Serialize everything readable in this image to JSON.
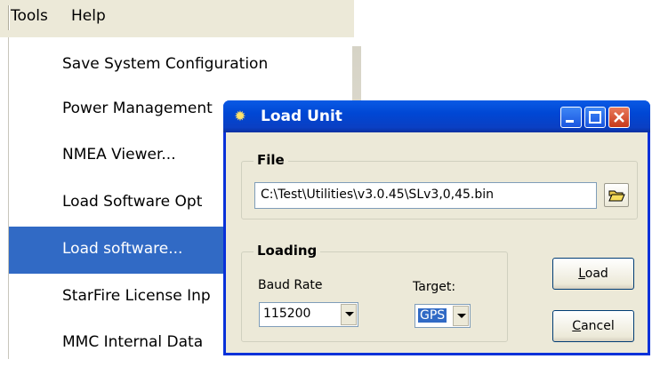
{
  "menubar": {
    "tools": "Tools",
    "help": "Help"
  },
  "menu": {
    "items": [
      "Save System Configuration",
      "Power Management",
      "NMEA Viewer...",
      "Load Software Opt",
      "Load software...",
      "StarFire License Inp",
      "MMC Internal Data"
    ]
  },
  "dialog": {
    "title": "Load Unit",
    "file_group": "File",
    "file_path": "C:\\Test\\Utilities\\v3.0.45\\SLv3,0,45.bin",
    "loading_group": "Loading",
    "baud_label": "Baud Rate",
    "baud_value": "115200",
    "target_label": "Target:",
    "target_value": "GPS",
    "load_first": "L",
    "load_rest": "oad",
    "cancel_first": "C",
    "cancel_rest": "ancel"
  },
  "colors": {
    "titlebar": "#0a5ae5",
    "selection": "#316ac5",
    "dialog_bg": "#ece9d8"
  },
  "icons": [
    "sun-app-icon",
    "minimize-icon",
    "maximize-icon",
    "close-icon",
    "folder-open-icon",
    "dropdown-arrow-icon"
  ]
}
